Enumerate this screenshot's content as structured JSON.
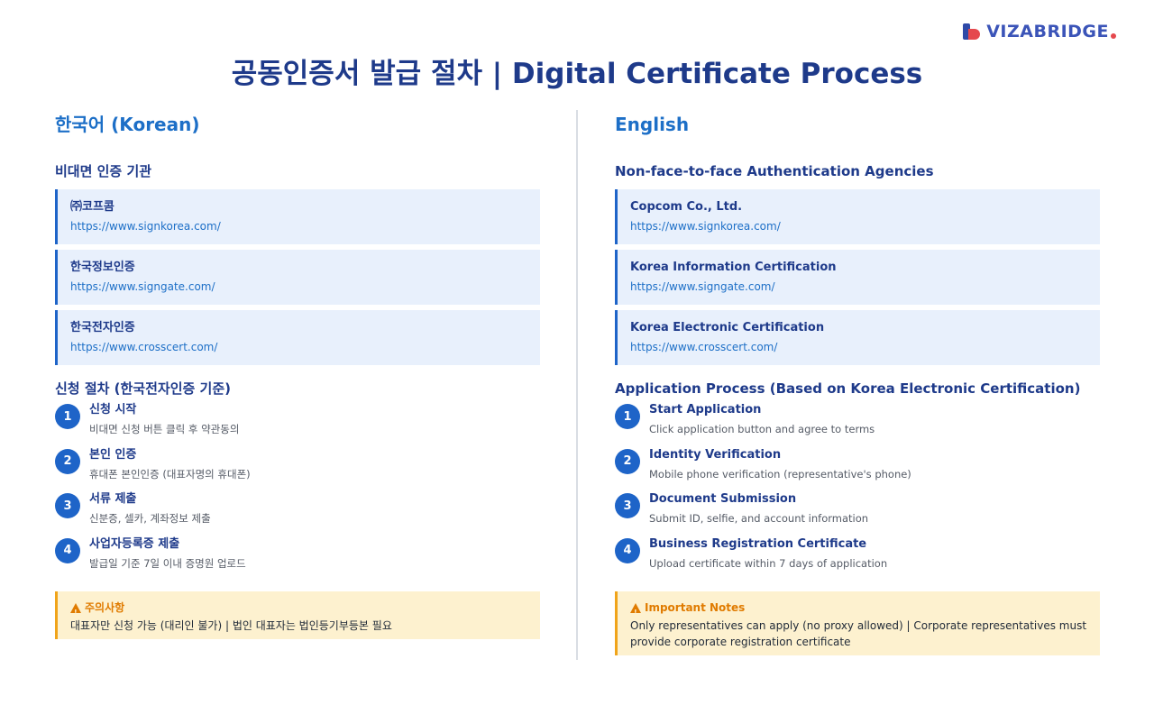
{
  "brand": {
    "name": "VIZABRIDGE"
  },
  "page": {
    "title": "공동인증서 발급 절차 | Digital Certificate Process"
  },
  "korean": {
    "lang_title": "한국어 (Korean)",
    "agencies_title": "비대면 인증 기관",
    "agencies": [
      {
        "name": "㈜코프콤",
        "url": "https://www.signkorea.com/"
      },
      {
        "name": "한국정보인증",
        "url": "https://www.signgate.com/"
      },
      {
        "name": "한국전자인증",
        "url": "https://www.crosscert.com/"
      }
    ],
    "process_title": "신청 절차 (한국전자인증 기준)",
    "steps": [
      {
        "num": "1",
        "title": "신청 시작",
        "desc": "비대면 신청 버튼 클릭 후 약관동의"
      },
      {
        "num": "2",
        "title": "본인 인증",
        "desc": "휴대폰 본인인증 (대표자명의 휴대폰)"
      },
      {
        "num": "3",
        "title": "서류 제출",
        "desc": "신분증, 셀카, 계좌정보 제출"
      },
      {
        "num": "4",
        "title": "사업자등록증 제출",
        "desc": "발급일 기준 7일 이내 증명원 업로드"
      }
    ],
    "notes_title": "주의사항",
    "notes_text": "대표자만 신청 가능 (대리인 불가) | 법인 대표자는 법인등기부등본 필요"
  },
  "english": {
    "lang_title": "English",
    "agencies_title": "Non-face-to-face Authentication Agencies",
    "agencies": [
      {
        "name": "Copcom Co., Ltd.",
        "url": "https://www.signkorea.com/"
      },
      {
        "name": "Korea Information Certification",
        "url": "https://www.signgate.com/"
      },
      {
        "name": "Korea Electronic Certification",
        "url": "https://www.crosscert.com/"
      }
    ],
    "process_title": "Application Process (Based on Korea Electronic Certification)",
    "steps": [
      {
        "num": "1",
        "title": "Start Application",
        "desc": "Click application button and agree to terms"
      },
      {
        "num": "2",
        "title": "Identity Verification",
        "desc": "Mobile phone verification (representative's phone)"
      },
      {
        "num": "3",
        "title": "Document Submission",
        "desc": "Submit ID, selfie, and account information"
      },
      {
        "num": "4",
        "title": "Business Registration Certificate",
        "desc": "Upload certificate within 7 days of application"
      }
    ],
    "notes_title": "Important Notes",
    "notes_text": "Only representatives can apply (no proxy allowed) | Corporate representatives must provide corporate registration certificate"
  },
  "colors": {
    "primary": "#1e3a8a",
    "accent": "#1d6fc7",
    "card_bg": "#e8f0fc",
    "warning": "#e07b00",
    "warning_bg": "#fdf1cf"
  }
}
